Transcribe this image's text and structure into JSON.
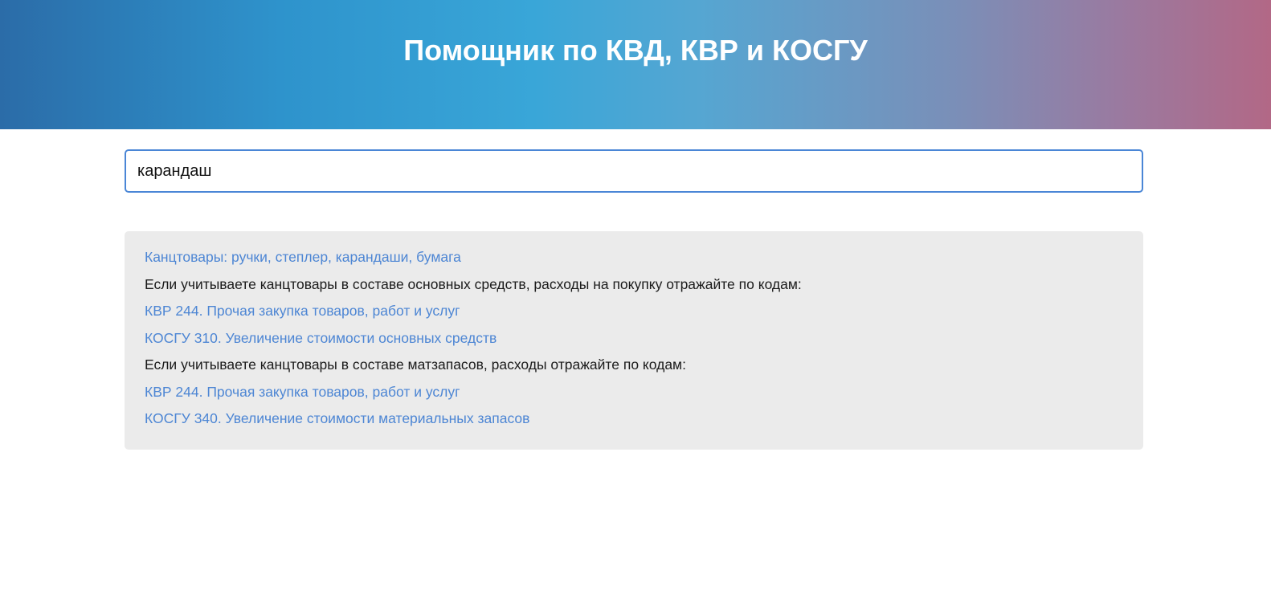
{
  "header": {
    "title": "Помощник по КВД, КВР и КОСГУ"
  },
  "search": {
    "value": "карандаш",
    "placeholder": ""
  },
  "results": {
    "items": [
      {
        "kind": "link",
        "text": "Канцтовары: ручки, степлер, карандаши, бумага"
      },
      {
        "kind": "text",
        "text": "Если учитываете канцтовары в составе основных средств, расходы на покупку отражайте по кодам:"
      },
      {
        "kind": "link",
        "text": "КВР 244. Прочая закупка товаров, работ и услуг"
      },
      {
        "kind": "link",
        "text": "КОСГУ 310. Увеличение стоимости основных средств"
      },
      {
        "kind": "text",
        "text": "Если учитываете канцтовары в составе матзапасов, расходы отражайте по кодам:"
      },
      {
        "kind": "link",
        "text": "КВР 244. Прочая закупка товаров, работ и услуг"
      },
      {
        "kind": "link",
        "text": "КОСГУ 340. Увеличение стоимости материальных запасов"
      }
    ]
  },
  "colors": {
    "link": "#4d86d4",
    "panel_background": "#ebebeb",
    "input_border": "#4a86d6"
  }
}
